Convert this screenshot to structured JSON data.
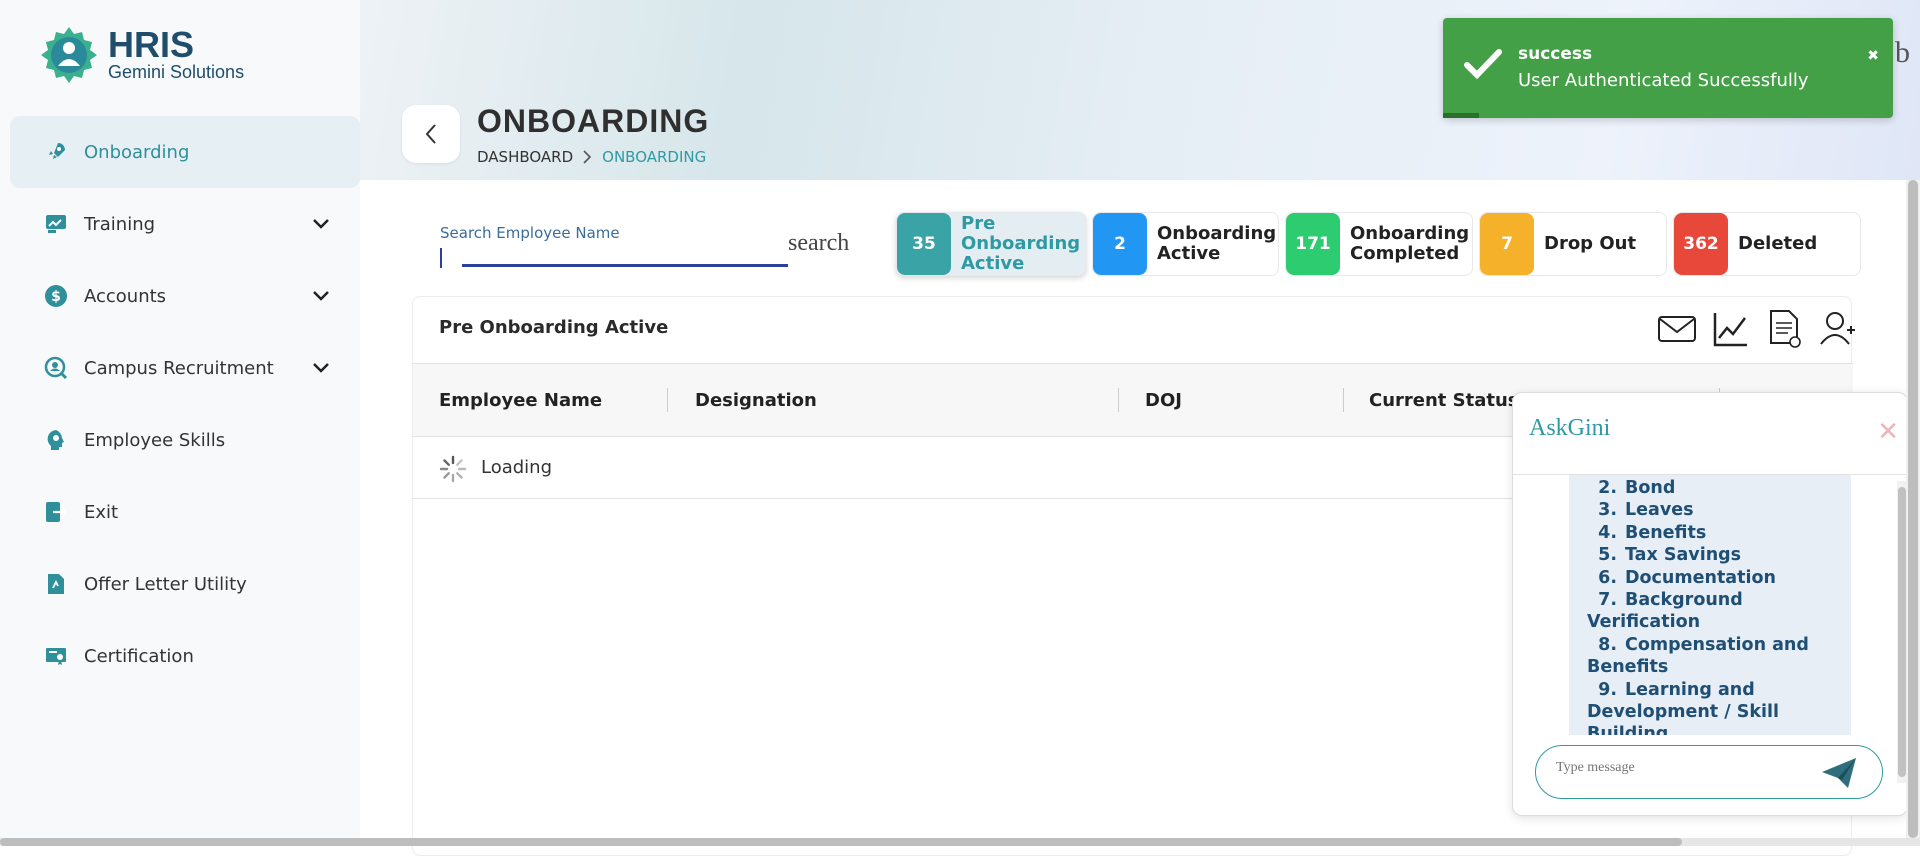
{
  "logo": {
    "title": "HRIS",
    "subtitle": "Gemini Solutions"
  },
  "sidebar": {
    "items": [
      {
        "label": "Onboarding",
        "icon": "rocket-icon",
        "active": true
      },
      {
        "label": "Training",
        "icon": "training-icon",
        "expandable": true
      },
      {
        "label": "Accounts",
        "icon": "dollar-icon",
        "expandable": true
      },
      {
        "label": "Campus Recruitment",
        "icon": "recruit-icon",
        "expandable": true
      },
      {
        "label": "Employee Skills",
        "icon": "skills-icon"
      },
      {
        "label": "Exit",
        "icon": "exit-icon"
      },
      {
        "label": "Offer Letter Utility",
        "icon": "document-icon"
      },
      {
        "label": "Certification",
        "icon": "certificate-icon"
      }
    ]
  },
  "header": {
    "title": "ONBOARDING",
    "breadcrumb": [
      "DASHBOARD",
      "ONBOARDING"
    ]
  },
  "search": {
    "placeholder": "Search Employee Name",
    "button_label": "search"
  },
  "tabs": [
    {
      "count": "35",
      "label": "Pre Onboarding Active",
      "color": "#3aa3a6",
      "selected": true
    },
    {
      "count": "2",
      "label": "Onboarding Active",
      "color": "#2196f3"
    },
    {
      "count": "171",
      "label": "Onboarding Completed",
      "color": "#2ecc71"
    },
    {
      "count": "7",
      "label": "Drop Out",
      "color": "#f5b12a"
    },
    {
      "count": "362",
      "label": "Deleted",
      "color": "#e8483a"
    }
  ],
  "table": {
    "title": "Pre Onboarding Active",
    "columns": [
      "Employee Name",
      "Designation",
      "DOJ",
      "Current Status"
    ],
    "loading_text": "Loading"
  },
  "toast": {
    "title": "success",
    "message": "User Authenticated Successfully",
    "color": "#43a047"
  },
  "background_glyph": "b",
  "chat": {
    "title": "AskGini",
    "items": [
      {
        "n": "2.",
        "text": "Bond"
      },
      {
        "n": "3.",
        "text": "Leaves"
      },
      {
        "n": "4.",
        "text": "Benefits"
      },
      {
        "n": "5.",
        "text": "Tax Savings"
      },
      {
        "n": "6.",
        "text": "Documentation"
      },
      {
        "n": "7.",
        "text": "Background Verification"
      },
      {
        "n": "8.",
        "text": "Compensation and Benefits"
      },
      {
        "n": "9.",
        "text": "Learning and Development / Skill Building"
      }
    ],
    "input_placeholder": "Type message"
  }
}
